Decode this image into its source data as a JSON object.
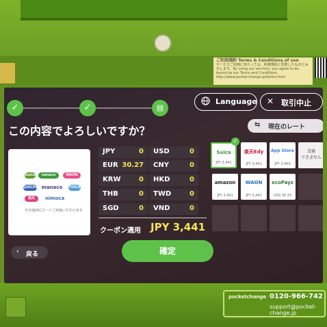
{
  "kiosk": {
    "terms_title": "ご利用規約  Terms & Conditions of use",
    "terms_text": "サービスご利用にあたっては、利用規約に同意したものとみなします。By using our services, you agree to be bound by our Terms and Conditions. http://www.pocket-change.jp/terms.html",
    "contact_logo": "pocketchange",
    "contact_phone": "0120-966-742",
    "contact_mail": "support@pocket-change.jp"
  },
  "header": {
    "steps": [
      "✓",
      "✓",
      "▤"
    ],
    "language_label": "Language",
    "cancel_label": "取引中止"
  },
  "question": "この内容でよろしいですか？",
  "rate_label": "現在のレート",
  "card": {
    "pills": [
      "Suica",
      "nanaco",
      "WAON",
      "QUICPay",
      "楽天Edy",
      "manaco",
      "nimoca",
      "TOICA"
    ],
    "caption": "その他JRICカードご利用いただけます"
  },
  "currencies": [
    {
      "code": "JPY",
      "value": "0"
    },
    {
      "code": "USD",
      "value": "0"
    },
    {
      "code": "EUR",
      "value": "30.27"
    },
    {
      "code": "CNY",
      "value": "0"
    },
    {
      "code": "KRW",
      "value": "0"
    },
    {
      "code": "HKD",
      "value": "0"
    },
    {
      "code": "THB",
      "value": "0"
    },
    {
      "code": "TWD",
      "value": "0"
    },
    {
      "code": "SGD",
      "value": "0"
    },
    {
      "code": "VND",
      "value": "0"
    }
  ],
  "coupon": {
    "label": "クーポン適用",
    "value": "JPY 3,441"
  },
  "tiles": [
    {
      "brand": "Suica",
      "amount": "JPY 3,441",
      "color": "#3a9a3a"
    },
    {
      "brand": "楽天Edy",
      "amount": "JPY 3,441",
      "color": "#c8102e"
    },
    {
      "brand": "App Store",
      "amount": "JPY 3,400",
      "color": "#2f7be0"
    },
    {
      "brand": "amazon",
      "amount": "JPY 3,441",
      "color": "#222222"
    },
    {
      "brand": "WAON",
      "amount": "JPY 3,441",
      "color": "#1f6fb5"
    },
    {
      "brand": "ecoPayz",
      "amount": "USD 30.25",
      "color": "#2d7a3a"
    }
  ],
  "tile_na": "交換\nできません",
  "back_label": "戻る",
  "confirm_label": "確定"
}
